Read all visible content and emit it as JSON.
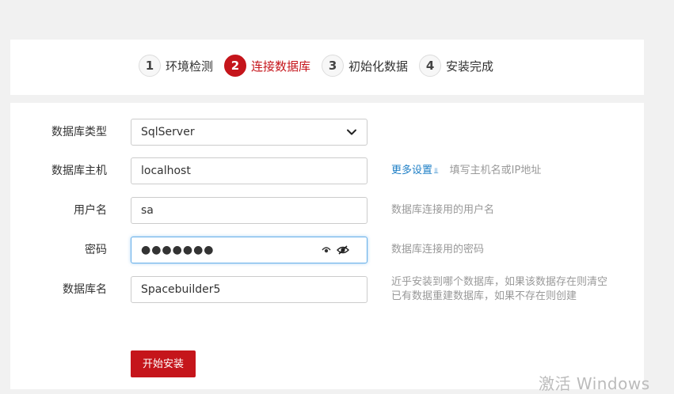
{
  "steps": [
    {
      "num": "1",
      "label": "环境检测"
    },
    {
      "num": "2",
      "label": "连接数据库"
    },
    {
      "num": "3",
      "label": "初始化数据"
    },
    {
      "num": "4",
      "label": "安装完成"
    }
  ],
  "active_step": 2,
  "form": {
    "db_type": {
      "label": "数据库类型",
      "value": "SqlServer"
    },
    "db_host": {
      "label": "数据库主机",
      "value": "localhost",
      "more_link": "更多设置",
      "hint": "填写主机名或IP地址"
    },
    "username": {
      "label": "用户名",
      "value": "sa",
      "hint": "数据库连接用的用户名"
    },
    "password": {
      "label": "密码",
      "value": "●●●●●●●",
      "hint": "数据库连接用的密码"
    },
    "db_name": {
      "label": "数据库名",
      "value": "Spacebuilder5",
      "hint_line1": "近乎安装到哪个数据库，如果该数据存在则清空",
      "hint_line2": "已有数据重建数据库，如果不存在则创建"
    },
    "install_button": "开始安装"
  },
  "watermark": "激活 Windows",
  "colors": {
    "accent": "#c5151b",
    "link": "#1e7fc6",
    "hint": "#999999"
  }
}
